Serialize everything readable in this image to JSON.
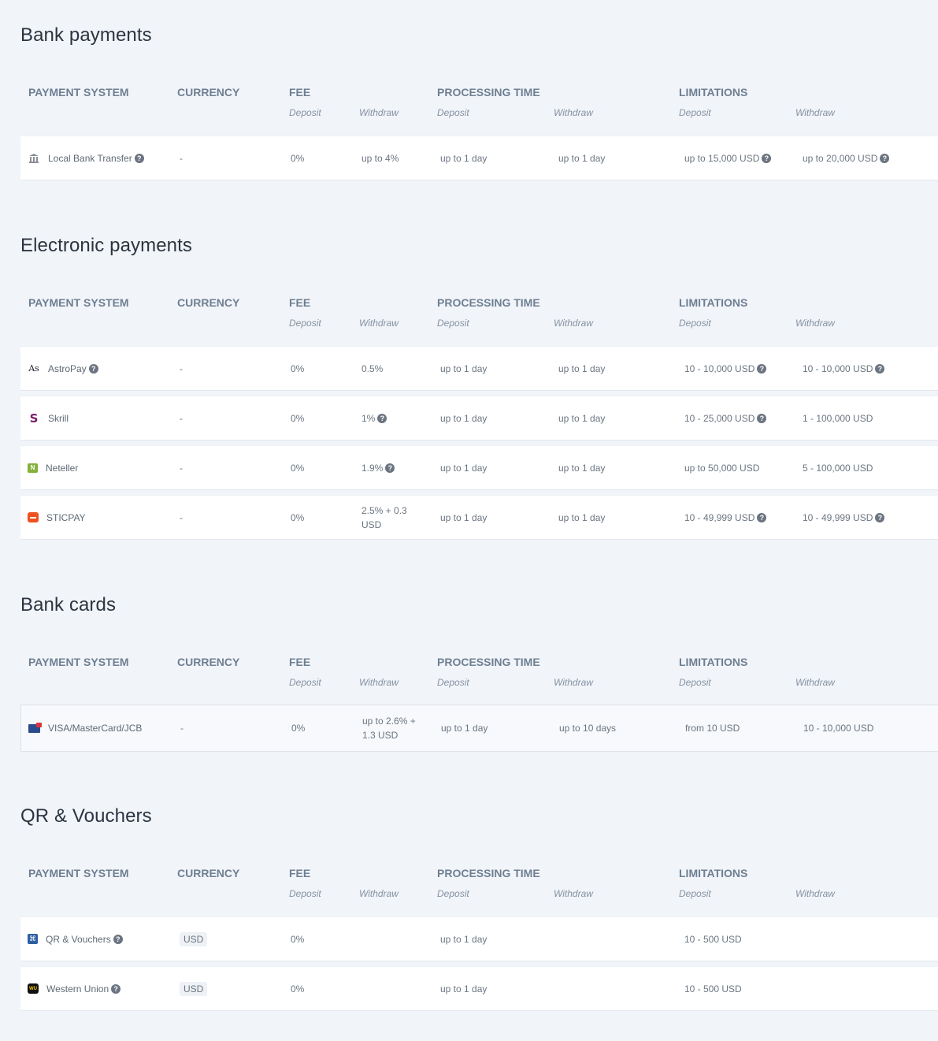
{
  "headers": {
    "payment_system": "PAYMENT SYSTEM",
    "currency": "CURRENCY",
    "fee": "FEE",
    "processing_time": "PROCESSING TIME",
    "limitations": "LIMITATIONS",
    "deposit": "Deposit",
    "withdraw": "Withdraw"
  },
  "sections": [
    {
      "title": "Bank payments",
      "rows": [
        {
          "icon": "bank-icon",
          "name": "Local Bank Transfer",
          "help": true,
          "currency": "-",
          "fee_deposit": "0%",
          "fee_withdraw": "up to 4%",
          "fee_withdraw_help": false,
          "time_deposit": "up to 1 day",
          "time_withdraw": "up to 1 day",
          "limit_deposit": "up to 15,000 USD",
          "limit_deposit_help": true,
          "limit_withdraw": "up to 20,000 USD",
          "limit_withdraw_help": true
        }
      ]
    },
    {
      "title": "Electronic payments",
      "rows": [
        {
          "icon": "astropay-icon",
          "name": "AstroPay",
          "help": true,
          "currency": "-",
          "fee_deposit": "0%",
          "fee_withdraw": "0.5%",
          "fee_withdraw_help": false,
          "time_deposit": "up to 1 day",
          "time_withdraw": "up to 1 day",
          "limit_deposit": "10 - 10,000 USD",
          "limit_deposit_help": true,
          "limit_withdraw": "10 - 10,000 USD",
          "limit_withdraw_help": true
        },
        {
          "icon": "skrill-icon",
          "name": "Skrill",
          "help": false,
          "currency": "-",
          "fee_deposit": "0%",
          "fee_withdraw": "1%",
          "fee_withdraw_help": true,
          "time_deposit": "up to 1 day",
          "time_withdraw": "up to 1 day",
          "limit_deposit": "10 - 25,000 USD",
          "limit_deposit_help": true,
          "limit_withdraw": "1 - 100,000 USD",
          "limit_withdraw_help": false
        },
        {
          "icon": "neteller-icon",
          "name": "Neteller",
          "help": false,
          "currency": "-",
          "fee_deposit": "0%",
          "fee_withdraw": "1.9%",
          "fee_withdraw_help": true,
          "time_deposit": "up to 1 day",
          "time_withdraw": "up to 1 day",
          "limit_deposit": "up to 50,000 USD",
          "limit_deposit_help": false,
          "limit_withdraw": "5 - 100,000 USD",
          "limit_withdraw_help": false
        },
        {
          "icon": "sticpay-icon",
          "name": "STICPAY",
          "help": false,
          "currency": "-",
          "fee_deposit": "0%",
          "fee_withdraw_line1": "2.5% + 0.3",
          "fee_withdraw_line2": "USD",
          "fee_withdraw_help": false,
          "time_deposit": "up to 1 day",
          "time_withdraw": "up to 1 day",
          "limit_deposit": "10 - 49,999 USD",
          "limit_deposit_help": true,
          "limit_withdraw": "10 - 49,999 USD",
          "limit_withdraw_help": true
        }
      ]
    },
    {
      "title": "Bank cards",
      "rows": [
        {
          "icon": "card-icon",
          "name": "VISA/MasterCard/JCB",
          "help": false,
          "currency": "-",
          "fee_deposit": "0%",
          "fee_withdraw_line1": "up to 2.6% +",
          "fee_withdraw_line2": "1.3 USD",
          "fee_withdraw_help": false,
          "time_deposit": "up to 1 day",
          "time_withdraw": "up to 10 days",
          "limit_deposit": "from 10 USD",
          "limit_deposit_help": false,
          "limit_withdraw": "10 - 10,000 USD",
          "limit_withdraw_help": false
        }
      ]
    },
    {
      "title": "QR & Vouchers",
      "rows": [
        {
          "icon": "qr-icon",
          "name": "QR & Vouchers",
          "help": true,
          "currency": "USD",
          "currency_badge": true,
          "fee_deposit": "0%",
          "fee_withdraw": "",
          "fee_withdraw_help": false,
          "time_deposit": "up to 1 day",
          "time_withdraw": "",
          "limit_deposit": "10 - 500 USD",
          "limit_deposit_help": false,
          "limit_withdraw": "",
          "limit_withdraw_help": false
        },
        {
          "icon": "western-union-icon",
          "name": "Western Union",
          "help": true,
          "currency": "USD",
          "currency_badge": true,
          "fee_deposit": "0%",
          "fee_withdraw": "",
          "fee_withdraw_help": false,
          "time_deposit": "up to 1 day",
          "time_withdraw": "",
          "limit_deposit": "10 - 500 USD",
          "limit_deposit_help": false,
          "limit_withdraw": "",
          "limit_withdraw_help": false
        }
      ]
    }
  ]
}
